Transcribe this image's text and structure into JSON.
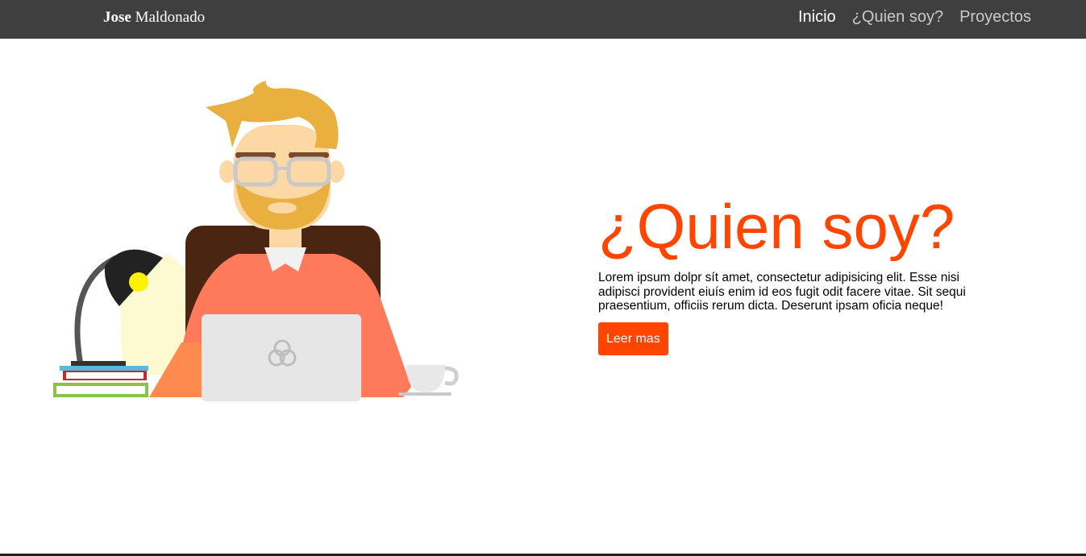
{
  "navbar": {
    "brand_first": "Jose",
    "brand_last": "Maldonado",
    "links": [
      {
        "label": "Inicio",
        "active": true
      },
      {
        "label": "¿Quien soy?",
        "active": false
      },
      {
        "label": "Proyectos",
        "active": false
      }
    ]
  },
  "hero": {
    "title": "¿Quien soy?",
    "text": "Lorem ipsum dolpr sít amet, consectetur adipisicing elit. Esse nisi adipisci provident eiuís enim id eos fugit odit facere vitae. Sit sequi praesentium, officiis rerum dicta. Deserunt ipsam oficia neque!",
    "button_label": "Leer mas",
    "illustration_icon": "developer-at-desk-illustration"
  },
  "colors": {
    "navbar_bg": "#3f3f3f",
    "accent": "#ff4500",
    "nav_active": "#ffffff",
    "nav_inactive": "#c9c9c9"
  }
}
